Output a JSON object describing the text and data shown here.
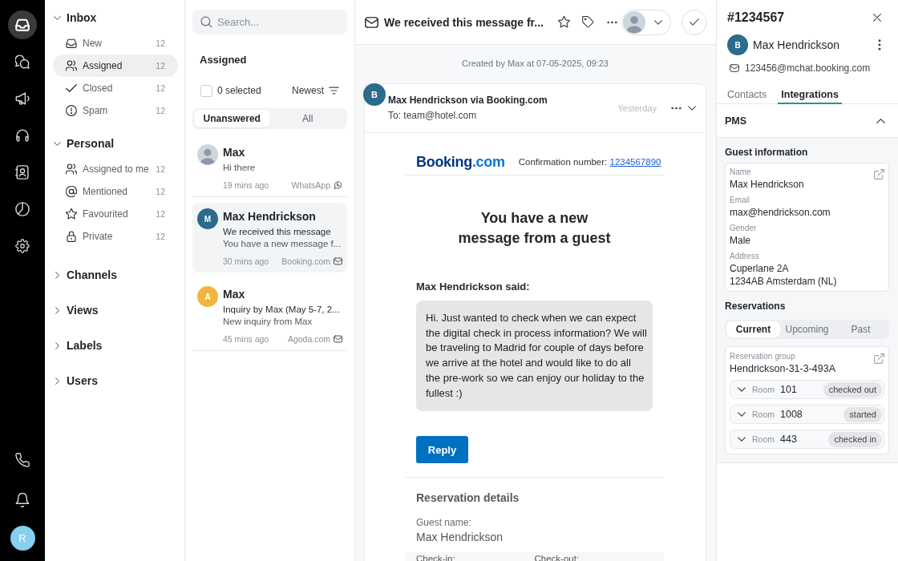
{
  "rail": {
    "items": [
      {
        "selected": true
      },
      {
        "selected": false
      },
      {
        "selected": false
      },
      {
        "selected": false
      },
      {
        "selected": false
      },
      {
        "selected": false
      },
      {
        "selected": false
      }
    ],
    "user_initial": "R"
  },
  "sidebar": {
    "sections": [
      {
        "title": "Inbox",
        "expanded": true,
        "items": [
          {
            "label": "New",
            "count": "12",
            "selected": false
          },
          {
            "label": "Assigned",
            "count": "12",
            "selected": true
          },
          {
            "label": "Closed",
            "count": "12",
            "selected": false
          },
          {
            "label": "Spam",
            "count": "12",
            "selected": false
          }
        ]
      },
      {
        "title": "Personal",
        "expanded": true,
        "items": [
          {
            "label": "Assigned to me",
            "count": "12",
            "selected": false
          },
          {
            "label": "Mentioned",
            "count": "12",
            "selected": false
          },
          {
            "label": "Favourited",
            "count": "12",
            "selected": false
          },
          {
            "label": "Private",
            "count": "12",
            "selected": false
          }
        ]
      },
      {
        "title": "Channels",
        "expanded": false
      },
      {
        "title": "Views",
        "expanded": false
      },
      {
        "title": "Labels",
        "expanded": false
      },
      {
        "title": "Users",
        "expanded": false
      }
    ]
  },
  "conversation_list": {
    "search": {
      "placeholder": "Search..."
    },
    "title": "Assigned",
    "select_all": {
      "label": "0 selected",
      "checked": false
    },
    "sort": "Newest",
    "filters": [
      {
        "label": "Unanswered",
        "selected": true
      },
      {
        "label": "All",
        "selected": false
      }
    ],
    "conversations": [
      {
        "kind": "whatsapp",
        "name": "Max",
        "avatar": {
          "kind": "photo"
        },
        "preview": "Hi there",
        "time": "19 mins ago",
        "channel": "WhatsApp",
        "selected": false
      },
      {
        "kind": "email",
        "name": "Max Hendrickson",
        "avatar": {
          "kind": "initial",
          "initial": "M",
          "color": "#2b6b8c"
        },
        "subject": "We received this message",
        "preview": "You have a new message f...",
        "time": "30 mins ago",
        "channel": "Booking.com",
        "selected": true
      },
      {
        "kind": "email",
        "name": "Max",
        "avatar": {
          "kind": "initial",
          "initial": "A",
          "color": "#f0b541"
        },
        "subject": "Inquiry by Max (May 5-7, 2...",
        "preview": "New inquiry from Max",
        "time": "45 mins ago",
        "channel": "Agoda.com",
        "selected": false
      }
    ]
  },
  "conversation": {
    "title": "We received this message fr...",
    "created_note": "Created by Max at 07-05-2025, 09:23",
    "message": {
      "avatar_initial": "B",
      "sender": "Max Hendrickson via Booking.com",
      "to": "To: team@hotel.com",
      "time": "Yesterday",
      "email": {
        "logo": {
          "name": "Booking",
          "suffix": ".com"
        },
        "confirmation_label": "Confirmation number:",
        "confirmation_number": "1234567890",
        "heading": [
          "You have a new",
          "message from a guest"
        ],
        "quote_label": "Max Hendrickson said:",
        "quote": "Hi. Just wanted to check when we can expect the digital check in process information? We will be traveling to Madrid for couple of days before we arrive at the hotel and would like to do all the pre-work so we can enjoy our holiday to the fullest :)",
        "button": "Reply",
        "details_title": "Reservation details",
        "guest_label": "Guest name:",
        "guest_name": "Max Hendrickson",
        "dates": [
          "Check-in:",
          "Check-out:"
        ]
      }
    }
  },
  "details_panel": {
    "ticket": "#1234567",
    "contact": {
      "initial": "B",
      "name": "Max Hendrickson",
      "email": "123456@mchat.booking.com"
    },
    "tabs": [
      {
        "label": "Contacts",
        "selected": false
      },
      {
        "label": "Integrations",
        "selected": true
      }
    ],
    "pms": {
      "title": "PMS",
      "expanded": true,
      "guest_title": "Guest information",
      "guest_fields": [
        {
          "label": "Name",
          "value": "Max Hendrickson"
        },
        {
          "label": "Email",
          "value": "max@hendrickson.com"
        },
        {
          "label": "Gender",
          "value": "Male"
        },
        {
          "label": "Address",
          "value": "Cuperlane 2A\n1234AB Amsterdam (NL)"
        }
      ],
      "reservations_title": "Reservations",
      "reservation_tabs": [
        {
          "label": "Current",
          "selected": true
        },
        {
          "label": "Upcoming",
          "selected": false
        },
        {
          "label": "Past",
          "selected": false
        }
      ],
      "group": {
        "label": "Reservation group",
        "value": "Hendrickson-31-3-493A",
        "rooms": [
          {
            "label": "Room",
            "number": "101",
            "status": "checked out",
            "expanded": false
          },
          {
            "label": "Room",
            "number": "1008",
            "status": "started",
            "expanded": false
          },
          {
            "label": "Room",
            "number": "443",
            "status": "checked in",
            "expanded": false
          }
        ]
      }
    }
  }
}
